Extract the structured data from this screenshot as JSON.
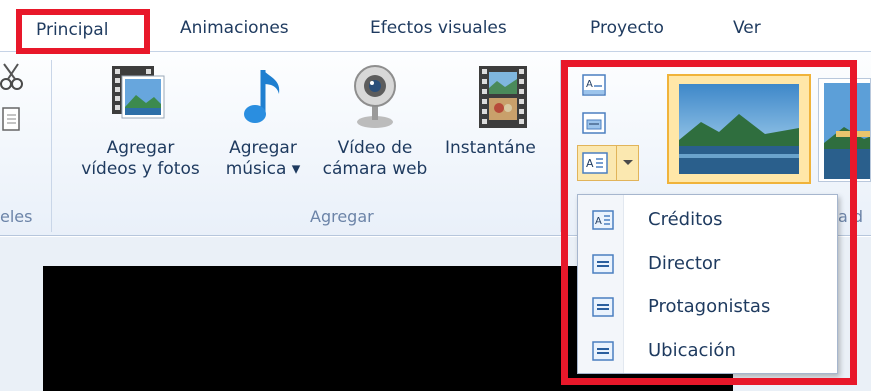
{
  "tabs": [
    {
      "label": "Principal",
      "active": true
    },
    {
      "label": "Animaciones"
    },
    {
      "label": "Efectos visuales"
    },
    {
      "label": "Proyecto"
    },
    {
      "label": "Ver"
    }
  ],
  "ribbon": {
    "left_group_label_partial": "eles",
    "buttons": [
      {
        "line1": "Agregar",
        "line2": "vídeos y fotos",
        "icon": "film-photo-icon"
      },
      {
        "line1": "Agregar",
        "line2": "música ▾",
        "icon": "music-note-icon"
      },
      {
        "line1": "Vídeo de",
        "line2": "cámara web",
        "icon": "webcam-icon"
      },
      {
        "line1": "Instantáne",
        "line2": "",
        "icon": "snapshot-icon"
      }
    ],
    "group_label": "Agregar",
    "right_group_label_partial": "a  d"
  },
  "menu": {
    "items": [
      {
        "label": "Créditos",
        "icon": "credits-icon"
      },
      {
        "label": "Director",
        "icon": "caption-icon"
      },
      {
        "label": "Protagonistas",
        "icon": "caption-icon"
      },
      {
        "label": "Ubicación",
        "icon": "caption-icon"
      }
    ]
  },
  "colors": {
    "accent": "#1e3a5f",
    "highlight_red": "#e8182a",
    "theme_selected": "#f5c15a"
  }
}
